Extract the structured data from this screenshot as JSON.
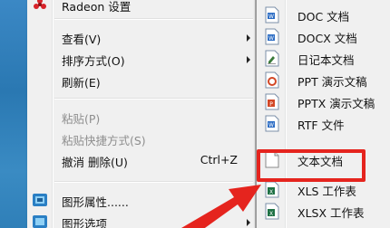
{
  "context_menu": {
    "items": [
      {
        "label": "Radeon 设置",
        "shortcut": "",
        "has_submenu": false,
        "disabled": false
      },
      {
        "label": "查看(V)",
        "shortcut": "",
        "has_submenu": true,
        "disabled": false
      },
      {
        "label": "排序方式(O)",
        "shortcut": "",
        "has_submenu": true,
        "disabled": false
      },
      {
        "label": "刷新(E)",
        "shortcut": "",
        "has_submenu": false,
        "disabled": false
      },
      {
        "label": "粘贴(P)",
        "shortcut": "",
        "has_submenu": false,
        "disabled": true
      },
      {
        "label": "粘贴快捷方式(S)",
        "shortcut": "",
        "has_submenu": false,
        "disabled": true
      },
      {
        "label": "撤消 删除(U)",
        "shortcut": "Ctrl+Z",
        "has_submenu": false,
        "disabled": false
      },
      {
        "label": "图形属性......",
        "shortcut": "",
        "has_submenu": false,
        "disabled": false
      },
      {
        "label": "图形选项",
        "shortcut": "",
        "has_submenu": true,
        "disabled": false
      }
    ]
  },
  "new_submenu": {
    "items": [
      {
        "label": "DOC 文档",
        "icon": "doc-file-icon"
      },
      {
        "label": "DOCX 文档",
        "icon": "docx-file-icon"
      },
      {
        "label": "日记本文档",
        "icon": "journal-file-icon"
      },
      {
        "label": "PPT 演示文稿",
        "icon": "ppt-file-icon"
      },
      {
        "label": "PPTX 演示文稿",
        "icon": "pptx-file-icon"
      },
      {
        "label": "RTF 文件",
        "icon": "rtf-file-icon"
      },
      {
        "label": "文本文档",
        "icon": "txt-file-icon",
        "highlighted": true
      },
      {
        "label": "XLS 工作表",
        "icon": "xls-file-icon"
      },
      {
        "label": "XLSX 工作表",
        "icon": "xlsx-file-icon"
      }
    ]
  },
  "colors": {
    "highlight_box": "#e5241e",
    "arrow": "#e5241e",
    "menu_bg": "#f0f0f0",
    "disabled_text": "#8e8e8e"
  }
}
